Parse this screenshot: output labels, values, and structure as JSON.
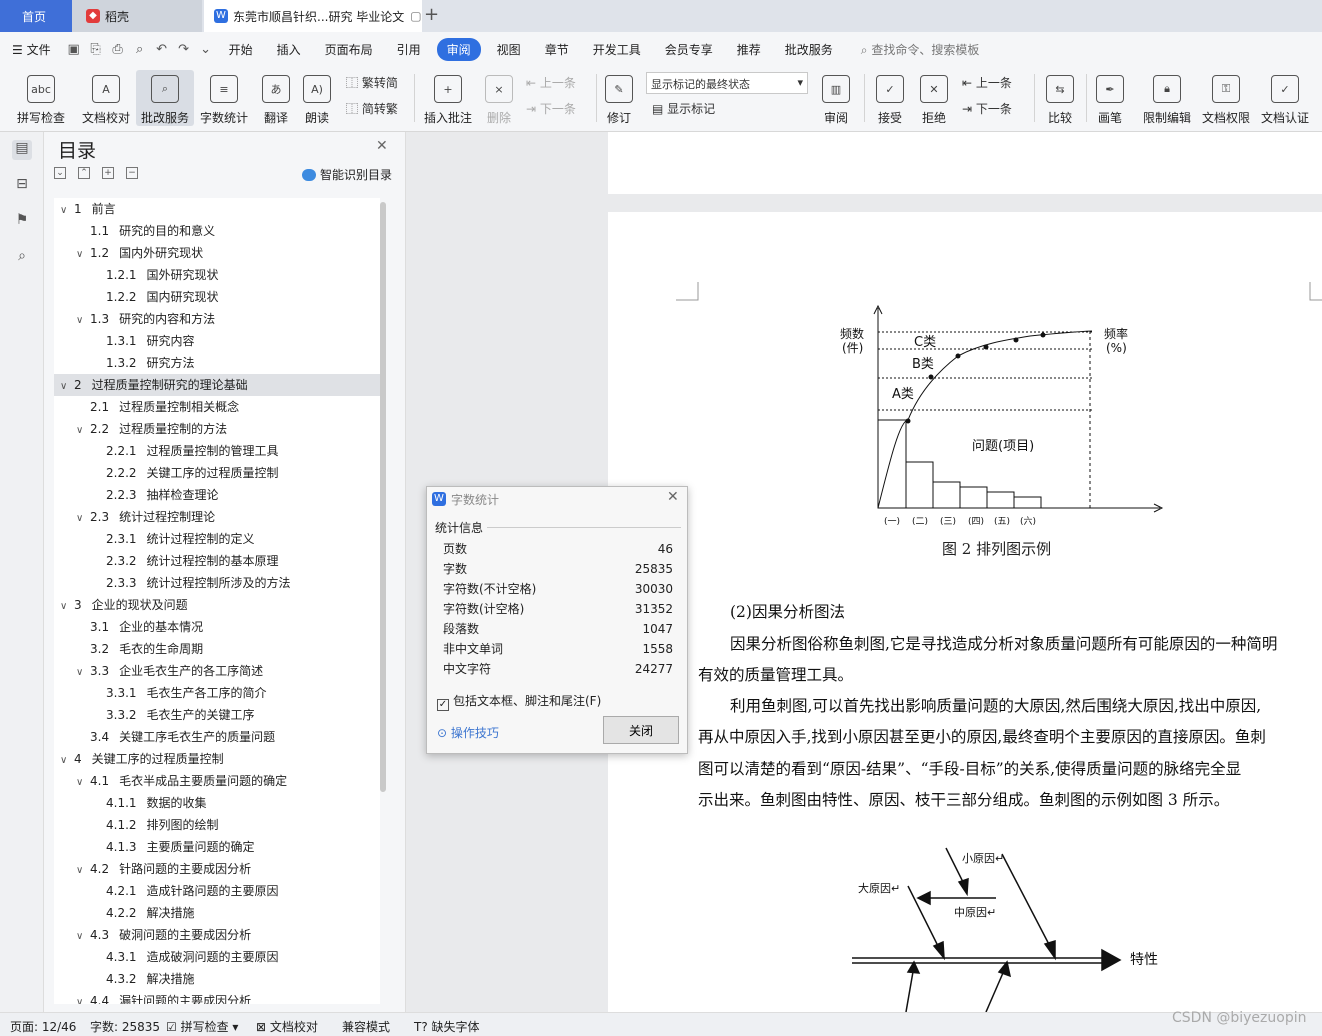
{
  "tabs": {
    "home": "首页",
    "daoke": "稻壳",
    "doc": "东莞市顺昌针织...研究 毕业论文"
  },
  "menu": {
    "file": "文件",
    "items": [
      "开始",
      "插入",
      "页面布局",
      "引用",
      "审阅",
      "视图",
      "章节",
      "开发工具",
      "会员专享",
      "推荐",
      "批改服务"
    ],
    "active": "审阅",
    "search": "查找命令、搜索模板"
  },
  "ribbon": {
    "spell": "拼写检查",
    "proof": "文档校对",
    "correct": "批改服务",
    "wordcount": "字数统计",
    "translate": "翻译",
    "read": "朗读",
    "to_trad": "繁转简",
    "to_simp": "简转繁",
    "insert_comment": "插入批注",
    "delete": "删除",
    "prev": "上一条",
    "next": "下一条",
    "revise": "修订",
    "markup_state": "显示标记的最终状态",
    "show_markup": "显示标记",
    "review": "审阅",
    "accept": "接受",
    "reject": "拒绝",
    "prev2": "上一条",
    "next2": "下一条",
    "compare": "比较",
    "pen": "画笔",
    "restrict": "限制编辑",
    "perm": "文档权限",
    "cert": "文档认证"
  },
  "toc": {
    "title": "目录",
    "smart": "智能识别目录",
    "items": [
      {
        "level": 1,
        "num": "1",
        "text": "前言",
        "chev": "∨"
      },
      {
        "level": 2,
        "num": "1.1",
        "text": "研究的目的和意义",
        "chev": ""
      },
      {
        "level": 2,
        "num": "1.2",
        "text": "国内外研究现状",
        "chev": "∨"
      },
      {
        "level": 3,
        "num": "1.2.1",
        "text": "国外研究现状",
        "chev": ""
      },
      {
        "level": 3,
        "num": "1.2.2",
        "text": "国内研究现状",
        "chev": ""
      },
      {
        "level": 2,
        "num": "1.3",
        "text": "研究的内容和方法",
        "chev": "∨"
      },
      {
        "level": 3,
        "num": "1.3.1",
        "text": "研究内容",
        "chev": ""
      },
      {
        "level": 3,
        "num": "1.3.2",
        "text": "研究方法",
        "chev": ""
      },
      {
        "level": 1,
        "num": "2",
        "text": "过程质量控制研究的理论基础",
        "chev": "∨",
        "sel": true
      },
      {
        "level": 2,
        "num": "2.1",
        "text": "过程质量控制相关概念",
        "chev": ""
      },
      {
        "level": 2,
        "num": "2.2",
        "text": "过程质量控制的方法",
        "chev": "∨"
      },
      {
        "level": 3,
        "num": "2.2.1",
        "text": "过程质量控制的管理工具",
        "chev": ""
      },
      {
        "level": 3,
        "num": "2.2.2",
        "text": "关键工序的过程质量控制",
        "chev": ""
      },
      {
        "level": 3,
        "num": "2.2.3",
        "text": "抽样检查理论",
        "chev": ""
      },
      {
        "level": 2,
        "num": "2.3",
        "text": "统计过程控制理论",
        "chev": "∨"
      },
      {
        "level": 3,
        "num": "2.3.1",
        "text": "统计过程控制的定义",
        "chev": ""
      },
      {
        "level": 3,
        "num": "2.3.2",
        "text": "统计过程控制的基本原理",
        "chev": ""
      },
      {
        "level": 3,
        "num": "2.3.3",
        "text": "统计过程控制所涉及的方法",
        "chev": ""
      },
      {
        "level": 1,
        "num": "3",
        "text": "企业的现状及问题",
        "chev": "∨"
      },
      {
        "level": 2,
        "num": "3.1",
        "text": "企业的基本情况",
        "chev": ""
      },
      {
        "level": 2,
        "num": "3.2",
        "text": "毛衣的生命周期",
        "chev": ""
      },
      {
        "level": 2,
        "num": "3.3",
        "text": "企业毛衣生产的各工序简述",
        "chev": "∨"
      },
      {
        "level": 3,
        "num": "3.3.1",
        "text": "毛衣生产各工序的简介",
        "chev": ""
      },
      {
        "level": 3,
        "num": "3.3.2",
        "text": "毛衣生产的关键工序",
        "chev": ""
      },
      {
        "level": 2,
        "num": "3.4",
        "text": "关键工序毛衣生产的质量问题",
        "chev": ""
      },
      {
        "level": 1,
        "num": "4",
        "text": "关键工序的过程质量控制",
        "chev": "∨"
      },
      {
        "level": 2,
        "num": "4.1",
        "text": "毛衣半成品主要质量问题的确定",
        "chev": "∨"
      },
      {
        "level": 3,
        "num": "4.1.1",
        "text": "数据的收集",
        "chev": ""
      },
      {
        "level": 3,
        "num": "4.1.2",
        "text": "排列图的绘制",
        "chev": ""
      },
      {
        "level": 3,
        "num": "4.1.3",
        "text": "主要质量问题的确定",
        "chev": ""
      },
      {
        "level": 2,
        "num": "4.2",
        "text": "针路问题的主要成因分析",
        "chev": "∨"
      },
      {
        "level": 3,
        "num": "4.2.1",
        "text": "造成针路问题的主要原因",
        "chev": ""
      },
      {
        "level": 3,
        "num": "4.2.2",
        "text": "解决措施",
        "chev": ""
      },
      {
        "level": 2,
        "num": "4.3",
        "text": "破洞问题的主要成因分析",
        "chev": "∨"
      },
      {
        "level": 3,
        "num": "4.3.1",
        "text": "造成破洞问题的主要原因",
        "chev": ""
      },
      {
        "level": 3,
        "num": "4.3.2",
        "text": "解决措施",
        "chev": ""
      },
      {
        "level": 2,
        "num": "4.4",
        "text": "漏针问题的主要成因分析",
        "chev": "∨"
      }
    ]
  },
  "dialog": {
    "title": "字数统计",
    "section": "统计信息",
    "rows": [
      {
        "label": "页数",
        "value": "46"
      },
      {
        "label": "字数",
        "value": "25835"
      },
      {
        "label": "字符数(不计空格)",
        "value": "30030"
      },
      {
        "label": "字符数(计空格)",
        "value": "31352"
      },
      {
        "label": "段落数",
        "value": "1047"
      },
      {
        "label": "非中文单词",
        "value": "1558"
      },
      {
        "label": "中文字符",
        "value": "24277"
      }
    ],
    "include": "包括文本框、脚注和尾注(F)",
    "tips": "操作技巧",
    "close": "关闭"
  },
  "doc": {
    "pareto": {
      "ylabel_left_1": "频数",
      "ylabel_left_2": "(件)",
      "ylabel_right_1": "频率",
      "ylabel_right_2": "(%)",
      "c": "C类",
      "b": "B类",
      "a": "A类",
      "problem": "问题(项目)",
      "x_ticks": [
        "(一)",
        "(二)",
        "(三)",
        "(四)",
        "(五)",
        "(六)"
      ]
    },
    "caption": "图 2   排列图示例",
    "p1": "(2)因果分析图法",
    "p2": "因果分析图俗称鱼刺图,它是寻找造成分析对象质量问题所有可能原因的一种简明",
    "p3": "有效的质量管理工具。",
    "p4": "利用鱼刺图,可以首先找出影响质量问题的大原因,然后围绕大原因,找出中原因,",
    "p5": "再从中原因入手,找到小原因甚至更小的原因,最终查明个主要原因的直接原因。鱼刺",
    "p6": "图可以清楚的看到“原因-结果”、“手段-目标”的关系,使得质量问题的脉络完全显",
    "p7": "示出来。鱼刺图由特性、原因、枝干三部分组成。鱼刺图的示例如图 3 所示。",
    "fish": {
      "small": "小原因↵",
      "big": "大原因↵",
      "mid": "中原因↵",
      "trait": "特性"
    }
  },
  "status": {
    "page": "页面: 12/46",
    "words": "字数: 25835",
    "spell": "拼写检查",
    "proof": "文档校对",
    "compat": "兼容模式",
    "font": "缺失字体"
  },
  "watermark": "CSDN @biyezuopin"
}
